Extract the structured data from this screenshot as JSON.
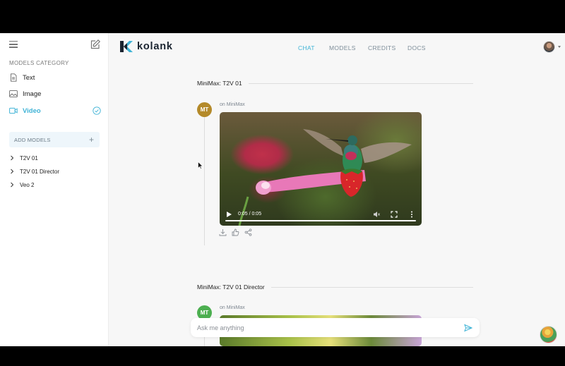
{
  "app": {
    "brand": "kolank",
    "accent": "#3fb3d6"
  },
  "sidebar": {
    "section_title": "MODELS CATEGORY",
    "categories": [
      {
        "label": "Text",
        "icon": "document-icon",
        "active": false
      },
      {
        "label": "Image",
        "icon": "image-icon",
        "active": false
      },
      {
        "label": "Video",
        "icon": "video-icon",
        "active": true
      }
    ],
    "add_models_label": "ADD MODELS",
    "add_models_icon": "plus-icon",
    "models": [
      {
        "label": "T2V 01"
      },
      {
        "label": "T2V 01 Director"
      },
      {
        "label": "Veo 2"
      }
    ]
  },
  "nav": {
    "items": [
      {
        "label": "CHAT",
        "active": true
      },
      {
        "label": "MODELS",
        "active": false
      },
      {
        "label": "CREDITS",
        "active": false
      },
      {
        "label": "DOCS",
        "active": false
      }
    ]
  },
  "chat": {
    "threads": [
      {
        "title": "MiniMax: T2V 01",
        "avatar_initials": "MT",
        "avatar_color": "#b48a2a",
        "on_label": "on MiniMax",
        "video_time": "0:05 / 0:05"
      },
      {
        "title": "MiniMax: T2V 01 Director",
        "avatar_initials": "MT",
        "avatar_color": "#4caf50",
        "on_label": "on MiniMax"
      }
    ]
  },
  "composer": {
    "placeholder": "Ask me anything",
    "value": ""
  }
}
